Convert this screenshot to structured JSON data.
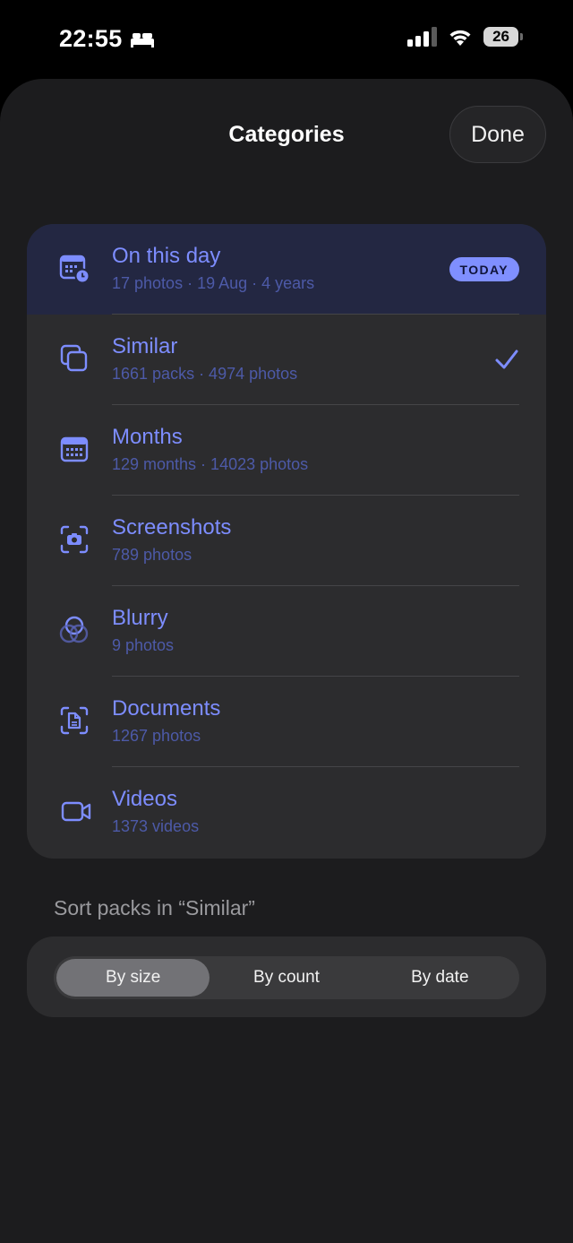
{
  "status": {
    "time": "22:55",
    "battery": "26"
  },
  "header": {
    "title": "Categories",
    "done_label": "Done"
  },
  "categories": [
    {
      "title": "On this day",
      "subtitle": "17 photos · 19 Aug · 4 years",
      "icon": "calendar-clock-icon",
      "badge": "TODAY",
      "highlighted": true
    },
    {
      "title": "Similar",
      "subtitle": "1661 packs · 4974 photos",
      "icon": "overlapping-squares-icon",
      "selected": true
    },
    {
      "title": "Months",
      "subtitle": "129 months · 14023 photos",
      "icon": "calendar-grid-icon"
    },
    {
      "title": "Screenshots",
      "subtitle": "789 photos",
      "icon": "screenshot-camera-icon"
    },
    {
      "title": "Blurry",
      "subtitle": "9 photos",
      "icon": "blur-circles-icon"
    },
    {
      "title": "Documents",
      "subtitle": "1267 photos",
      "icon": "document-scan-icon"
    },
    {
      "title": "Videos",
      "subtitle": "1373 videos",
      "icon": "video-camera-icon"
    }
  ],
  "sort": {
    "label": "Sort packs in “Similar”",
    "options": [
      "By size",
      "By count",
      "By date"
    ],
    "selected": "By size"
  },
  "colors": {
    "accent": "#7d8dff",
    "subtitle": "#4d5aa8",
    "card": "#2c2c2e",
    "sheet": "#1c1c1e"
  }
}
